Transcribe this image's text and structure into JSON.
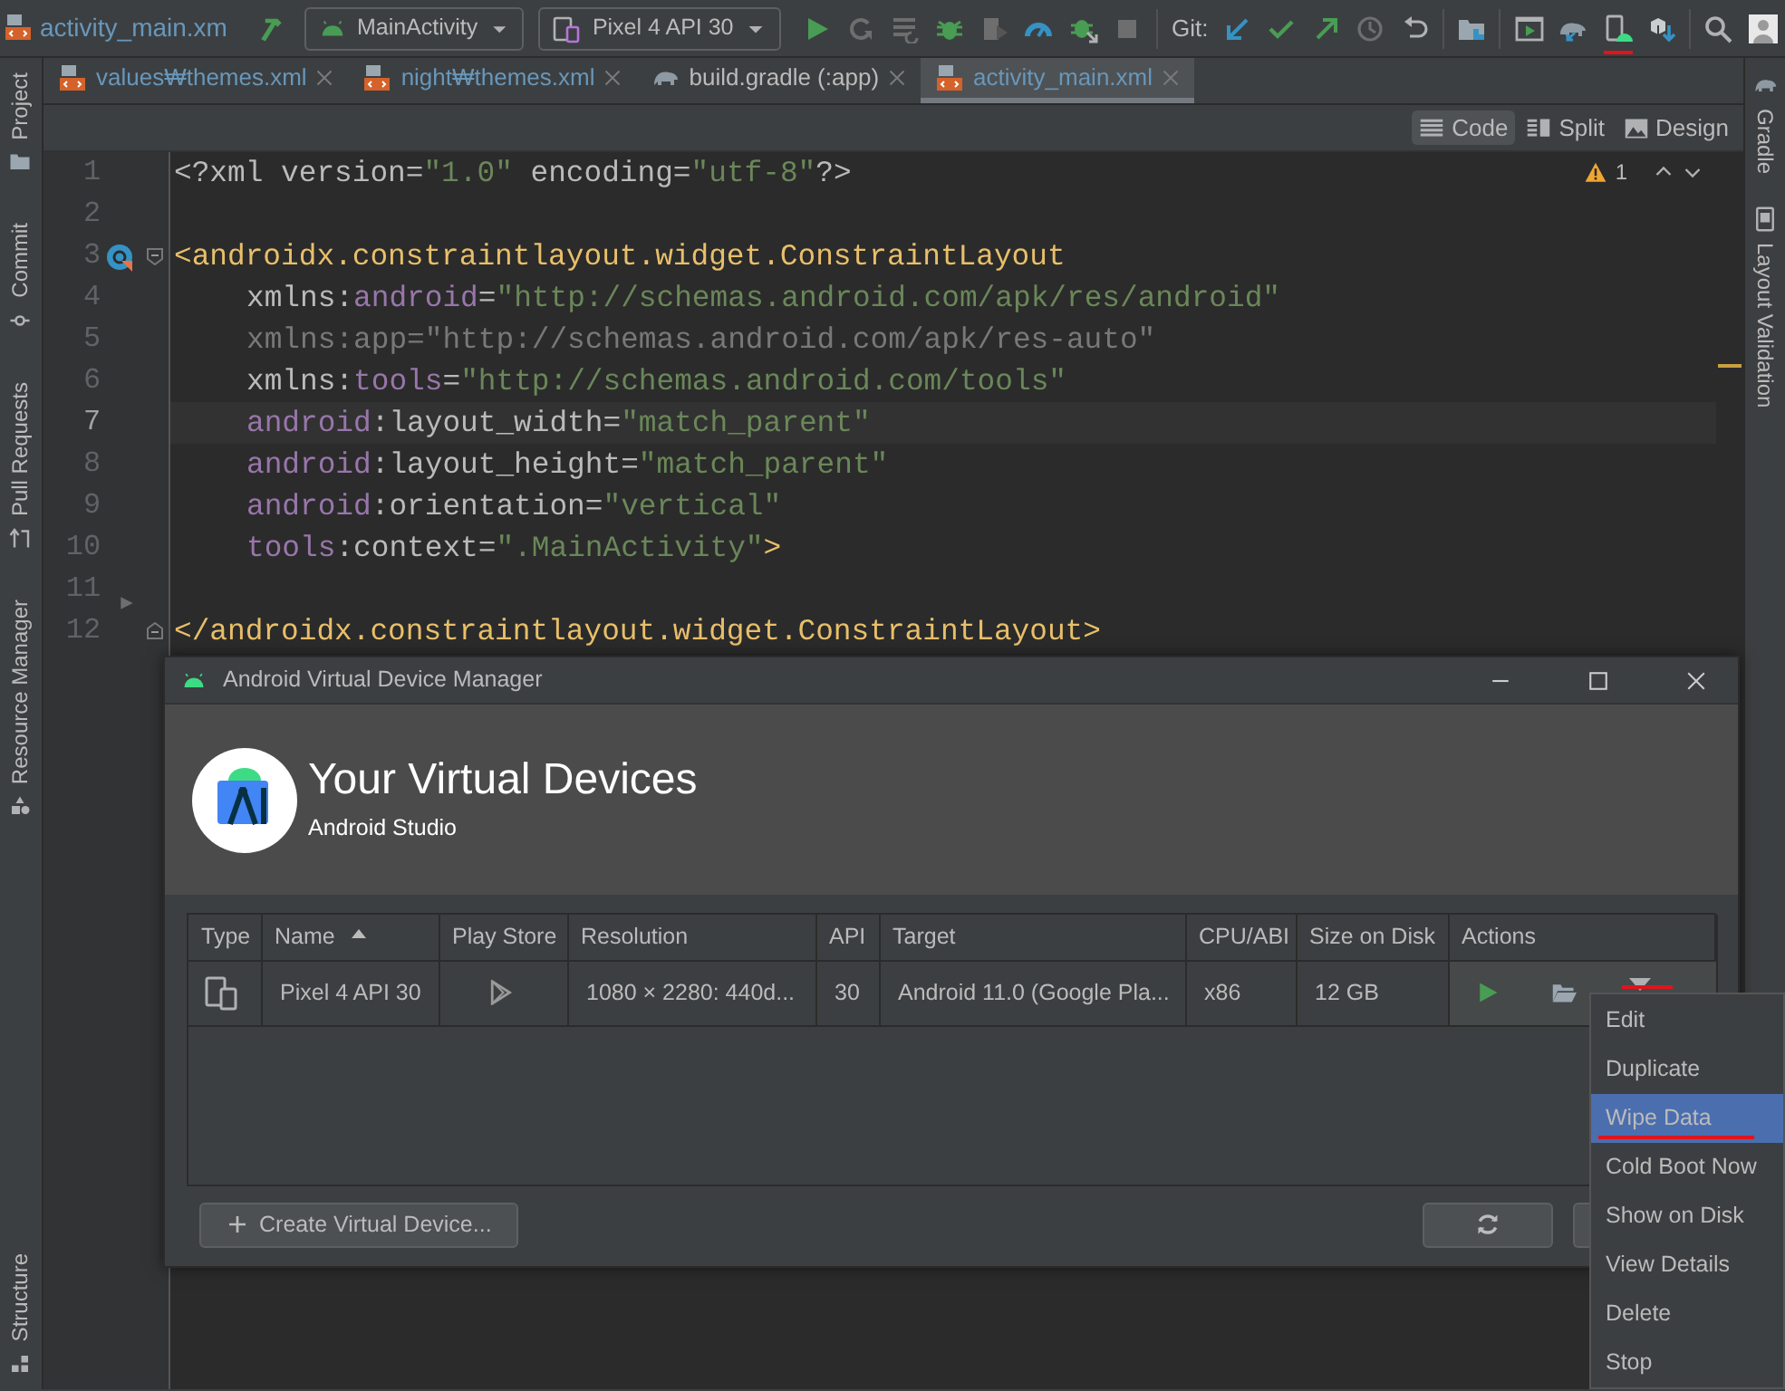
{
  "toolbar": {
    "file_name": "activity_main.xm",
    "run_config": "MainActivity",
    "device": "Pixel 4 API 30",
    "git_label": "Git:",
    "device_manager_annotated": true
  },
  "left_tool_windows": [
    {
      "label": "Project",
      "kind": "project"
    },
    {
      "label": "Commit",
      "kind": "commit"
    },
    {
      "label": "Pull Requests",
      "kind": "pull"
    },
    {
      "label": "Resource Manager",
      "kind": "resource"
    }
  ],
  "left_tool_windows_bottom": [
    {
      "label": "Structure",
      "kind": "structure"
    }
  ],
  "right_tool_windows": [
    {
      "label": "Gradle",
      "kind": "gradle"
    },
    {
      "label": "Layout Validation",
      "kind": "validation"
    }
  ],
  "tabs": [
    {
      "label": "values₩themes.xml",
      "kind": "xml",
      "color": "#6897bb",
      "selected": false
    },
    {
      "label": "night₩themes.xml",
      "kind": "xml",
      "color": "#6897bb",
      "selected": false
    },
    {
      "label": "build.gradle (:app)",
      "kind": "gradle",
      "color": "#bbbbbb",
      "selected": false
    },
    {
      "label": "activity_main.xml",
      "kind": "xml",
      "color": "#6897bb",
      "selected": true
    }
  ],
  "view_modes": [
    {
      "label": "Code",
      "kind": "code",
      "selected": true
    },
    {
      "label": "Split",
      "kind": "split",
      "selected": false
    },
    {
      "label": "Design",
      "kind": "design",
      "selected": false
    }
  ],
  "editor": {
    "warning_count": "1",
    "lines": [
      {
        "number": "1",
        "current": false,
        "indented": false,
        "segments": [
          {
            "text": "<?xml version=",
            "kind": "attr"
          },
          {
            "text": "\"1.0\"",
            "kind": "value"
          },
          {
            "text": " encoding=",
            "kind": "attr"
          },
          {
            "text": "\"utf-8\"",
            "kind": "value"
          },
          {
            "text": "?>",
            "kind": "attr"
          }
        ]
      },
      {
        "number": "2",
        "current": false
      },
      {
        "number": "3",
        "current": false,
        "indented": false,
        "gutter": {
          "kind": "layout"
        },
        "fold": {
          "kind": "start"
        },
        "segments": [
          {
            "text": "<androidx.constraintlayout.widget.ConstraintLayout",
            "kind": "tag"
          }
        ]
      },
      {
        "number": "4",
        "current": false,
        "indented": true,
        "segments": [
          {
            "text": "xmlns:",
            "kind": "attr"
          },
          {
            "text": "android",
            "kind": "ns"
          },
          {
            "text": "=",
            "kind": "attr"
          },
          {
            "text": "\"http://schemas.android.com/apk/res/android\"",
            "kind": "value"
          }
        ]
      },
      {
        "number": "5",
        "current": false,
        "indented": true,
        "segments": [
          {
            "text": "xmlns:app=\"http://schemas.android.com/apk/res-auto\"",
            "kind": "unused"
          }
        ]
      },
      {
        "number": "6",
        "current": false,
        "indented": true,
        "segments": [
          {
            "text": "xmlns:",
            "kind": "attr"
          },
          {
            "text": "tools",
            "kind": "ns"
          },
          {
            "text": "=",
            "kind": "attr"
          },
          {
            "text": "\"http://schemas.android.com/tools\"",
            "kind": "value"
          }
        ]
      },
      {
        "number": "7",
        "current": true,
        "indented": true,
        "segments": [
          {
            "text": "android",
            "kind": "ns"
          },
          {
            "text": ":layout_width=",
            "kind": "attr"
          },
          {
            "text": "\"match_parent\"",
            "kind": "value"
          }
        ]
      },
      {
        "number": "8",
        "current": false,
        "indented": true,
        "segments": [
          {
            "text": "android",
            "kind": "ns"
          },
          {
            "text": ":layout_height=",
            "kind": "attr"
          },
          {
            "text": "\"match_parent\"",
            "kind": "value"
          }
        ]
      },
      {
        "number": "9",
        "current": false,
        "indented": true,
        "segments": [
          {
            "text": "android",
            "kind": "ns"
          },
          {
            "text": ":orientation=",
            "kind": "attr"
          },
          {
            "text": "\"vertical\"",
            "kind": "value"
          }
        ]
      },
      {
        "number": "10",
        "current": false,
        "indented": true,
        "segments": [
          {
            "text": "tools",
            "kind": "ns"
          },
          {
            "text": ":context=",
            "kind": "attr"
          },
          {
            "text": "\".MainActivity\"",
            "kind": "value"
          },
          {
            "text": ">",
            "kind": "tag"
          }
        ]
      },
      {
        "number": "11",
        "current": false
      },
      {
        "number": "12",
        "current": false,
        "indented": false,
        "gutter": {
          "kind": "arrow"
        },
        "fold": {
          "kind": "end"
        },
        "segments": [
          {
            "text": "</androidx.constraintlayout.widget.ConstraintLayout>",
            "kind": "tag"
          }
        ]
      }
    ]
  },
  "avd_manager": {
    "title": "Android Virtual Device Manager",
    "heading": "Your Virtual Devices",
    "subheading": "Android Studio",
    "columns": [
      {
        "label": "Type"
      },
      {
        "label": "Name",
        "sorted_ascending": true
      },
      {
        "label": "Play Store"
      },
      {
        "label": "Resolution"
      },
      {
        "label": "API"
      },
      {
        "label": "Target"
      },
      {
        "label": "CPU/ABI"
      },
      {
        "label": "Size on Disk"
      },
      {
        "label": "Actions"
      }
    ],
    "rows": [
      {
        "kind": "phone",
        "name": "Pixel 4 API 30",
        "play_store": true,
        "resolution": "1080 × 2280: 440d...",
        "api": "30",
        "target": "Android 11.0 (Google Pla...",
        "cpu_abi": "x86",
        "size_on_disk": "12 GB",
        "menu_annotated": true
      }
    ],
    "create_button": "Create Virtual Device..."
  },
  "context_menu": [
    {
      "label": "Edit",
      "selected": false,
      "annotated": false
    },
    {
      "label": "Duplicate",
      "selected": false,
      "annotated": false
    },
    {
      "label": "Wipe Data",
      "selected": true,
      "annotated": true
    },
    {
      "label": "Cold Boot Now",
      "selected": false,
      "annotated": false
    },
    {
      "label": "Show on Disk",
      "selected": false,
      "annotated": false
    },
    {
      "label": "View Details",
      "selected": false,
      "annotated": false
    },
    {
      "label": "Delete",
      "selected": false,
      "annotated": false
    },
    {
      "label": "Stop",
      "selected": false,
      "annotated": false
    }
  ]
}
